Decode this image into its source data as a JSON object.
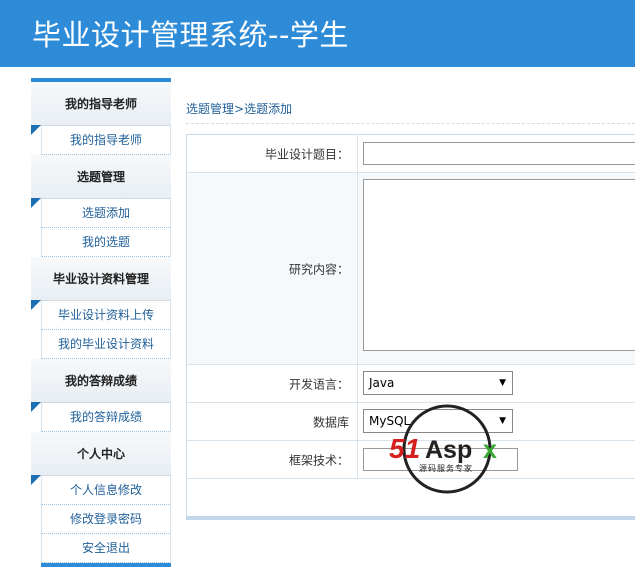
{
  "header": {
    "title": "毕业设计管理系统--学生"
  },
  "sidebar": {
    "groups": [
      {
        "title": "我的指导老师",
        "items": [
          "我的指导老师"
        ]
      },
      {
        "title": "选题管理",
        "items": [
          "选题添加",
          "我的选题"
        ]
      },
      {
        "title": "毕业设计资料管理",
        "items": [
          "毕业设计资料上传",
          "我的毕业设计资料"
        ]
      },
      {
        "title": "我的答辩成绩",
        "items": [
          "我的答辩成绩"
        ]
      },
      {
        "title": "个人中心",
        "items": [
          "个人信息修改",
          "修改登录密码",
          "安全退出"
        ]
      }
    ]
  },
  "breadcrumb": {
    "parent": "选题管理",
    "separator": ">",
    "current": "选题添加"
  },
  "form": {
    "title_label": "毕业设计题目：",
    "title_value": "",
    "content_label": "研究内容：",
    "content_value": "",
    "language_label": "开发语言：",
    "language_selected": "Java",
    "database_label": "数据库",
    "database_selected": "MySQL",
    "framework_label": "框架技术：",
    "framework_value": ""
  },
  "watermark": {
    "brand": "51Aspx",
    "tagline": "源码服务专家"
  },
  "colors": {
    "header_bg": "#2e8bd8",
    "link": "#1f5f99",
    "border": "#d6e2ec"
  }
}
